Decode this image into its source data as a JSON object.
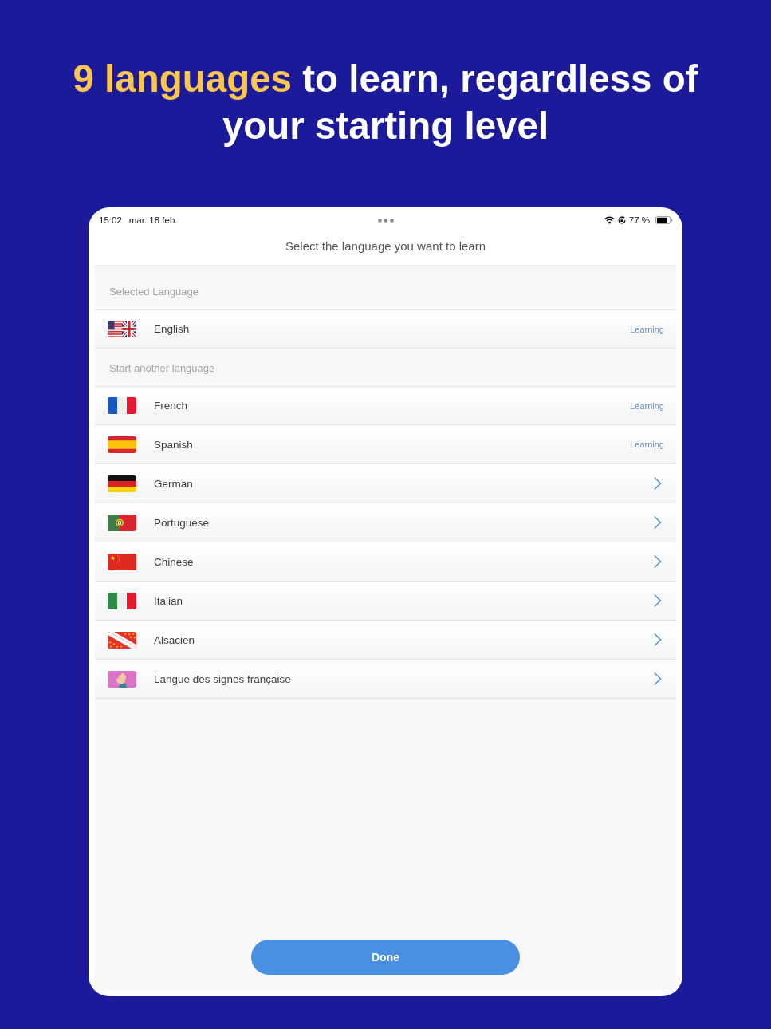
{
  "headline": {
    "highlight": "9 languages",
    "text": "to learn, regardless of your starting level"
  },
  "status_bar": {
    "time": "15:02",
    "date": "mar. 18 feb.",
    "battery_percent": "77 %"
  },
  "screen": {
    "title": "Select the language you want to learn",
    "sections": [
      {
        "header": "Selected Language",
        "items": [
          {
            "name": "English",
            "kind": "usuk",
            "status": "Learning"
          }
        ]
      },
      {
        "header": "Start another language",
        "items": [
          {
            "name": "French",
            "kind": "france",
            "status": "Learning"
          },
          {
            "name": "Spanish",
            "kind": "spain",
            "status": "Learning"
          },
          {
            "name": "German",
            "kind": "germany"
          },
          {
            "name": "Portuguese",
            "kind": "portugal"
          },
          {
            "name": "Chinese",
            "kind": "china"
          },
          {
            "name": "Italian",
            "kind": "italy"
          },
          {
            "name": "Alsacien",
            "kind": "alsace"
          },
          {
            "name": "Langue des signes française",
            "kind": "signing"
          }
        ]
      }
    ],
    "done_button": "Done"
  }
}
